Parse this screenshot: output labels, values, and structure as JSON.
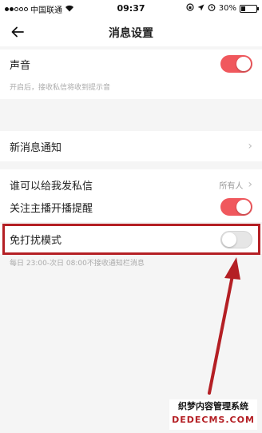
{
  "status_bar": {
    "carrier": "中国联通",
    "time": "09:37",
    "battery": "30%",
    "battery_level": 0.3
  },
  "header": {
    "title": "消息设置"
  },
  "settings": {
    "sound": {
      "label": "声音",
      "enabled": true,
      "hint": "开启后，接收私信将收到提示音"
    },
    "new_message": {
      "label": "新消息通知"
    },
    "who_can_message": {
      "label": "谁可以给我发私信",
      "value": "所有人"
    },
    "follow_live": {
      "label": "关注主播开播提醒",
      "enabled": true
    },
    "do_not_disturb": {
      "label": "免打扰模式",
      "enabled": false,
      "hint": "每日 23:00-次日 08:00不接收通知栏消息"
    }
  },
  "colors": {
    "toggle_on": "#f0585d",
    "annotation": "#b41f24"
  },
  "watermark": {
    "line1": "织梦内容管理系统",
    "line2": "DEDECMS.COM"
  }
}
